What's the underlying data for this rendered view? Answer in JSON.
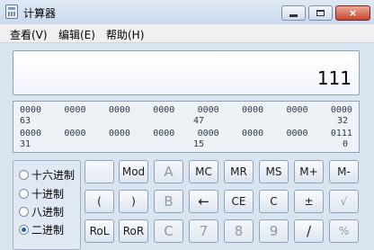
{
  "window": {
    "title": "计算器",
    "icon": "calculator-icon",
    "controls": {
      "minimize": "minimize-icon",
      "maximize": "maximize-icon",
      "close": "×"
    }
  },
  "menu": [
    "查看(V)",
    "编辑(E)",
    "帮助(H)"
  ],
  "display": {
    "value": "111"
  },
  "bits": {
    "row1": [
      "0000",
      "0000",
      "0000",
      "0000",
      "0000",
      "0000",
      "0000",
      "0000"
    ],
    "row1_idx": [
      "63",
      "47",
      "32"
    ],
    "row2": [
      "0000",
      "0000",
      "0000",
      "0000",
      "0000",
      "0000",
      "0000",
      "0111"
    ],
    "row2_idx": [
      "31",
      "15",
      "0"
    ]
  },
  "radix": {
    "options": [
      "十六进制",
      "十进制",
      "八进制",
      "二进制"
    ],
    "selected_index": 3
  },
  "keys": {
    "row1": [
      "",
      "Mod",
      "A",
      "MC",
      "MR",
      "MS",
      "M+",
      "M-"
    ],
    "row2": [
      "(",
      ")",
      "B",
      "←",
      "CE",
      "C",
      "±",
      "√"
    ],
    "row3": [
      "RoL",
      "RoR",
      "C",
      "7",
      "8",
      "9",
      "/",
      "%"
    ]
  },
  "colors": {
    "accent": "#1f5fb4",
    "close_button": "#c8452f",
    "window_bg": "#d9e4f1"
  }
}
